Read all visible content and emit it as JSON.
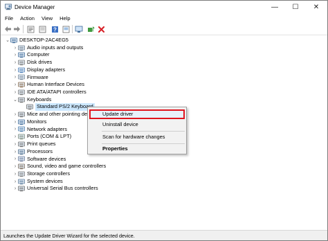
{
  "window": {
    "title": "Device Manager",
    "icon": "device-manager-icon",
    "controls": {
      "minimize": "—",
      "maximize": "☐",
      "close": "✕"
    }
  },
  "menubar": {
    "items": [
      "File",
      "Action",
      "View",
      "Help"
    ]
  },
  "toolbar": {
    "buttons": [
      "back-arrow-icon",
      "forward-arrow-icon",
      "properties-icon",
      "show-hidden-icon",
      "help-icon",
      "update-driver-icon",
      "monitor-icon",
      "scan-hardware-icon",
      "uninstall-x-icon"
    ]
  },
  "tree": {
    "root": "DESKTOP-2AC4EG5",
    "categories": [
      {
        "label": "Audio inputs and outputs",
        "icon": "speaker-icon"
      },
      {
        "label": "Computer",
        "icon": "computer-icon"
      },
      {
        "label": "Disk drives",
        "icon": "disk-drive-icon"
      },
      {
        "label": "Display adapters",
        "icon": "display-adapter-icon"
      },
      {
        "label": "Firmware",
        "icon": "firmware-icon"
      },
      {
        "label": "Human Interface Devices",
        "icon": "hid-icon"
      },
      {
        "label": "IDE ATA/ATAPI controllers",
        "icon": "ide-controller-icon"
      },
      {
        "label": "Keyboards",
        "icon": "keyboard-icon",
        "expanded": true,
        "children": [
          "Standard PS/2 Keyboard"
        ]
      },
      {
        "label": "Mice and other pointing de",
        "icon": "mouse-icon"
      },
      {
        "label": "Monitors",
        "icon": "monitor-icon"
      },
      {
        "label": "Network adapters",
        "icon": "network-adapter-icon"
      },
      {
        "label": "Ports (COM & LPT)",
        "icon": "port-icon"
      },
      {
        "label": "Print queues",
        "icon": "printer-icon"
      },
      {
        "label": "Processors",
        "icon": "processor-icon"
      },
      {
        "label": "Software devices",
        "icon": "software-device-icon"
      },
      {
        "label": "Sound, video and game controllers",
        "icon": "sound-controller-icon"
      },
      {
        "label": "Storage controllers",
        "icon": "storage-controller-icon"
      },
      {
        "label": "System devices",
        "icon": "system-device-icon"
      },
      {
        "label": "Universal Serial Bus controllers",
        "icon": "usb-icon"
      }
    ]
  },
  "context_menu": {
    "items": [
      "Update driver",
      "Uninstall device",
      "Scan for hardware changes",
      "Properties"
    ]
  },
  "statusbar": {
    "text": "Launches the Update Driver Wizard for the selected device."
  },
  "colors": {
    "highlight_border": "#e0141e",
    "selection": "#cce8ff"
  }
}
